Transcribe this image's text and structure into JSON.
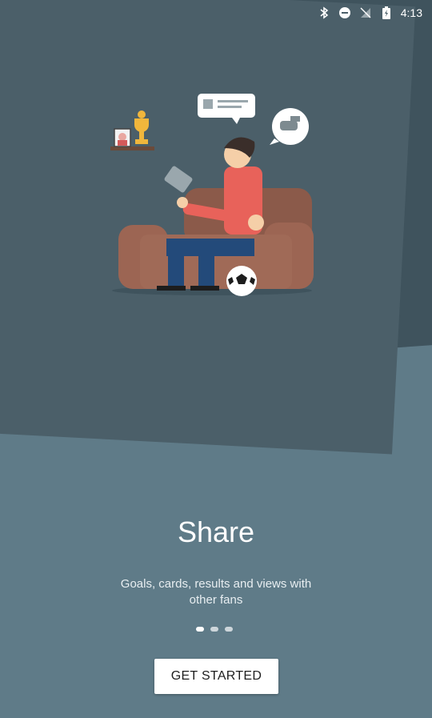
{
  "status_bar": {
    "time": "4:13",
    "icons": [
      "bluetooth-icon",
      "do-not-disturb-icon",
      "no-signal-icon",
      "battery-charging-icon"
    ]
  },
  "onboarding": {
    "title": "Share",
    "description": "Goals, cards, results and views with other fans",
    "page_indicator": {
      "total": 3,
      "active_index": 0
    },
    "cta_label": "GET STARTED"
  },
  "colors": {
    "background": "#5f7b88",
    "card": "#4b5f69",
    "button": "#ffffff"
  }
}
